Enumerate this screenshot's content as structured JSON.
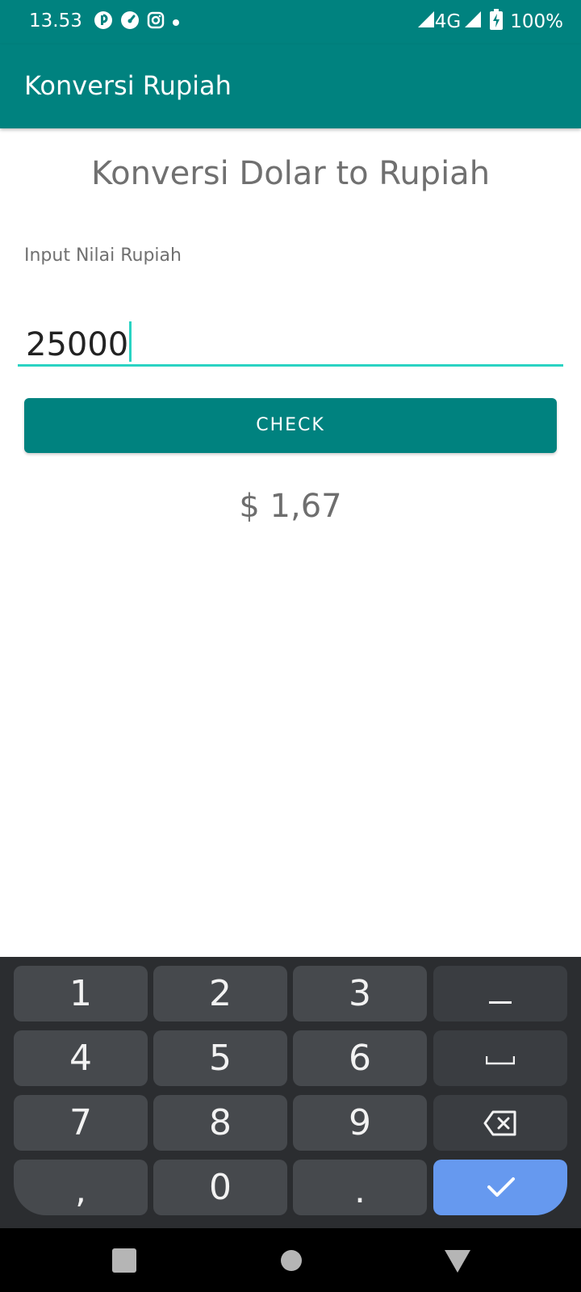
{
  "status_bar": {
    "time": "13.53",
    "network": "4G",
    "battery": "100%"
  },
  "app_bar": {
    "title": "Konversi Rupiah"
  },
  "main": {
    "heading": "Konversi Dolar to Rupiah",
    "input_label": "Input Nilai Rupiah",
    "input_value": "25000",
    "check_label": "CHECK",
    "result": "$ 1,67"
  },
  "keyboard": {
    "keys": [
      "1",
      "2",
      "3",
      "4",
      "5",
      "6",
      "7",
      "8",
      "9",
      ",",
      "0",
      "."
    ],
    "icons": [
      "minus-icon",
      "space-icon",
      "backspace-icon",
      "check-icon"
    ]
  },
  "navigation": {
    "icons": [
      "recents-icon",
      "home-icon",
      "back-icon"
    ]
  },
  "colors": {
    "primary": "#00827f",
    "accent": "#2ad3c3",
    "enter_key": "#6699ef",
    "keyboard_bg": "#2b2d30"
  }
}
